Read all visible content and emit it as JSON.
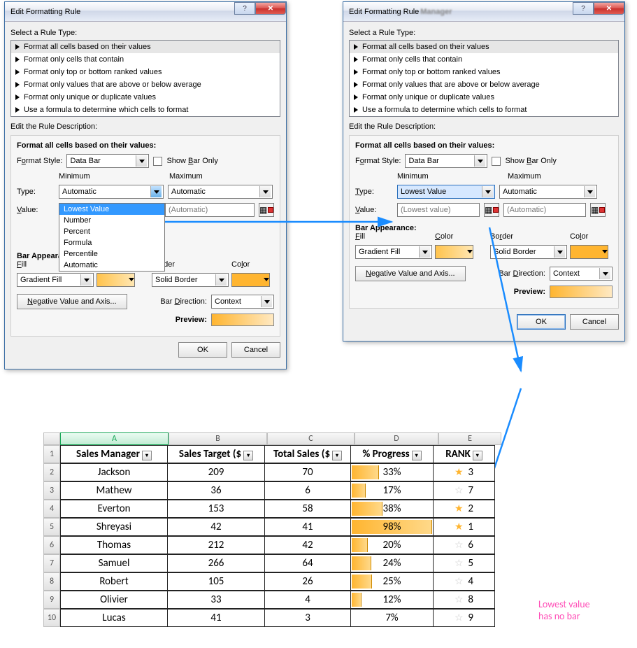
{
  "dialog": {
    "title": "Edit Formatting Rule",
    "title_blur": "Manager",
    "select_label": "Select a Rule Type:",
    "rule_types": [
      "Format all cells based on their values",
      "Format only cells that contain",
      "Format only top or bottom ranked values",
      "Format only values that are above or below average",
      "Format only unique or duplicate values",
      "Use a formula to determine which cells to format"
    ],
    "edit_label": "Edit the Rule Description:",
    "format_all_label": "Format all cells based on their values:",
    "format_style_label": "Format Style:",
    "format_style_value": "Data Bar",
    "show_bar_only": "Show Bar Only",
    "min_label": "Minimum",
    "max_label": "Maximum",
    "type_label": "Type:",
    "value_label": "Value:",
    "type_min_left": "Automatic",
    "type_min_right": "Lowest Value",
    "type_max": "Automatic",
    "value_min_left": "",
    "value_min_right": "(Lowest value)",
    "value_max": "(Automatic)",
    "dd_options": [
      "Lowest Value",
      "Number",
      "Percent",
      "Formula",
      "Percentile",
      "Automatic"
    ],
    "bar_appearance": "Bar Appearance:",
    "fill": "Fill",
    "color": "Color",
    "border": "Border",
    "fill_val": "Gradient Fill",
    "border_val": "Solid Border",
    "neg_btn": "Negative Value and Axis...",
    "bar_dir_label": "Bar Direction:",
    "bar_dir_val": "Context",
    "preview": "Preview:",
    "ok": "OK",
    "cancel": "Cancel"
  },
  "annotation_text": "Lowest value\nhas no bar",
  "columns": [
    "A",
    "B",
    "C",
    "D",
    "E"
  ],
  "headers": [
    "Sales Manager",
    "Sales Target ($)",
    "Total Sales ($)",
    "% Progress",
    "RANK"
  ],
  "headers_display": [
    "Sales Manager",
    "Sales Target ($",
    "Total Sales ($",
    "% Progress",
    "RANK"
  ],
  "rows": [
    {
      "n": 2,
      "mgr": "Jackson",
      "target": 209,
      "sales": 70,
      "pct": "33%",
      "bar": 33,
      "star": true,
      "rank": 3
    },
    {
      "n": 3,
      "mgr": "Mathew",
      "target": 36,
      "sales": 6,
      "pct": "17%",
      "bar": 17,
      "star": false,
      "rank": 7
    },
    {
      "n": 4,
      "mgr": "Everton",
      "target": 153,
      "sales": 58,
      "pct": "38%",
      "bar": 38,
      "star": true,
      "rank": 2
    },
    {
      "n": 5,
      "mgr": "Shreyasi",
      "target": 42,
      "sales": 41,
      "pct": "98%",
      "bar": 98,
      "star": true,
      "rank": 1
    },
    {
      "n": 6,
      "mgr": "Thomas",
      "target": 212,
      "sales": 42,
      "pct": "20%",
      "bar": 20,
      "star": false,
      "rank": 6
    },
    {
      "n": 7,
      "mgr": "Samuel",
      "target": 266,
      "sales": 64,
      "pct": "24%",
      "bar": 24,
      "star": false,
      "rank": 5
    },
    {
      "n": 8,
      "mgr": "Robert",
      "target": 105,
      "sales": 26,
      "pct": "25%",
      "bar": 25,
      "star": false,
      "rank": 4
    },
    {
      "n": 9,
      "mgr": "Olivier",
      "target": 33,
      "sales": 4,
      "pct": "12%",
      "bar": 12,
      "star": false,
      "rank": 8
    },
    {
      "n": 10,
      "mgr": "Lucas",
      "target": 41,
      "sales": 3,
      "pct": "7%",
      "bar": 0,
      "star": false,
      "rank": 9
    }
  ]
}
